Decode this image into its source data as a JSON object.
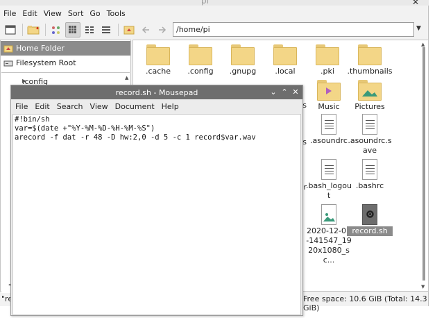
{
  "file_manager": {
    "window_title": "pi",
    "close_glyph": "✕",
    "menu": [
      "File",
      "Edit",
      "View",
      "Sort",
      "Go",
      "Tools"
    ],
    "path": "/home/pi",
    "sidebar": {
      "items": [
        {
          "label": "Home Folder",
          "icon": "home-icon"
        },
        {
          "label": "Filesystem Root",
          "icon": "drive-icon"
        }
      ],
      "tree_item": ".config"
    },
    "files": [
      {
        "name": ".cache",
        "type": "folder"
      },
      {
        "name": ".config",
        "type": "folder"
      },
      {
        "name": ".gnupg",
        "type": "folder"
      },
      {
        "name": ".local",
        "type": "folder"
      },
      {
        "name": ".pki",
        "type": "folder"
      },
      {
        "name": ".thumbnails",
        "type": "folder"
      },
      {
        "name": "Music",
        "type": "folder-music"
      },
      {
        "name": "Pictures",
        "type": "folder-pictures"
      },
      {
        "name": ".asoundrc",
        "type": "text"
      },
      {
        "name": ".asoundrc.save",
        "type": "text"
      },
      {
        "name": ".bash_logout",
        "type": "text"
      },
      {
        "name": ".bashrc",
        "type": "text"
      },
      {
        "name": "2020-12-07-141547_1920x1080_sc...",
        "type": "image"
      },
      {
        "name": "record.sh",
        "type": "script",
        "selected": true
      }
    ],
    "partial_labels": {
      "s1": "s",
      "s2": "s",
      "r": "r"
    },
    "status_left": "\"rec",
    "status_right": "Free space: 10.6 GiB (Total: 14.3 GiB)"
  },
  "editor": {
    "window_title": "record.sh - Mousepad",
    "controls": {
      "minimize": "⌄",
      "maximize": "⌃",
      "close": "✕"
    },
    "menu": [
      "File",
      "Edit",
      "Search",
      "View",
      "Document",
      "Help"
    ],
    "lines": [
      "#!bin/sh",
      "var=$(date +\"%Y-%M-%D-%H-%M-%S\")",
      "arecord -f dat -r 48 -D hw:2,0 -d 5 -c 1 record$var.wav"
    ]
  },
  "colors": {
    "folder": "#f3d687",
    "selection": "#8b8b8b",
    "editor_titlebar": "#6e6e6e"
  }
}
